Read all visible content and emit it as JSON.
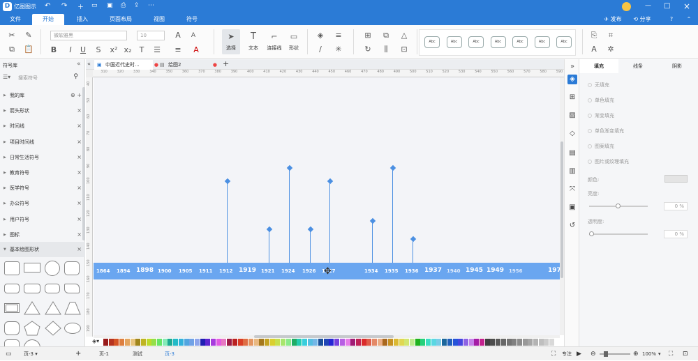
{
  "app": {
    "title": "亿图图示",
    "logo": "D"
  },
  "titlebar_right": {
    "publish": "发布",
    "share": "分享",
    "help": "?",
    "minimize": "—",
    "restore": "□",
    "close": "×"
  },
  "menu": {
    "file": "文件",
    "start": "开始",
    "insert": "插入",
    "page_layout": "页面布局",
    "view": "视图",
    "symbol": "符号"
  },
  "ribbon": {
    "font_name": "微软雅黑",
    "font_size": "10",
    "select_label": "选择",
    "text_label": "文本",
    "connector_label": "连接线",
    "shape_label": "形状",
    "style_boxes": [
      "Abc",
      "Abc",
      "Abc",
      "Abc",
      "Abc",
      "Abc",
      "Abc"
    ]
  },
  "left_panel": {
    "title": "符号库",
    "search_placeholder": "搜索符号",
    "items": [
      {
        "label": "我的库"
      },
      {
        "label": "箭头形状"
      },
      {
        "label": "时间线"
      },
      {
        "label": "项目时间线"
      },
      {
        "label": "日常生活符号"
      },
      {
        "label": "教育符号"
      },
      {
        "label": "医学符号"
      },
      {
        "label": "办公符号"
      },
      {
        "label": "用户符号"
      },
      {
        "label": "图标"
      }
    ],
    "open_section": "基本绘图形状"
  },
  "doc_tabs": [
    {
      "label": "中国近代史时..."
    },
    {
      "label": "绘图2"
    }
  ],
  "ruler": {
    "h": [
      "300",
      "310",
      "320",
      "330",
      "340",
      "350",
      "360",
      "370",
      "380",
      "390",
      "400",
      "410",
      "420",
      "430",
      "440",
      "450",
      "460",
      "470",
      "480",
      "490",
      "500",
      "510",
      "520",
      "530",
      "540",
      "550",
      "560",
      "570",
      "580",
      "590"
    ],
    "v": [
      "40",
      "50",
      "60",
      "70",
      "80",
      "90",
      "100",
      "110",
      "120",
      "130",
      "140",
      "150",
      "160",
      "170",
      "180",
      "190"
    ]
  },
  "timeline": {
    "years": [
      {
        "label": "1864",
        "big": false,
        "light": false
      },
      {
        "label": "1894",
        "big": false,
        "light": false
      },
      {
        "label": "1898",
        "big": true,
        "light": false
      },
      {
        "label": "1900",
        "big": false,
        "light": false
      },
      {
        "label": "1905",
        "big": false,
        "light": false
      },
      {
        "label": "1911",
        "big": false,
        "light": false
      },
      {
        "label": "1912",
        "big": false,
        "light": false
      },
      {
        "label": "1919",
        "big": true,
        "light": false
      },
      {
        "label": "1921",
        "big": false,
        "light": false
      },
      {
        "label": "1924",
        "big": false,
        "light": false
      },
      {
        "label": "1926",
        "big": false,
        "light": false
      },
      {
        "label": "1927",
        "big": false,
        "light": false
      },
      {
        "label": "1934",
        "big": false,
        "light": false
      },
      {
        "label": "1935",
        "big": false,
        "light": false
      },
      {
        "label": "1936",
        "big": false,
        "light": false
      },
      {
        "label": "1937",
        "big": true,
        "light": false
      },
      {
        "label": "1940",
        "big": false,
        "light": true
      },
      {
        "label": "1945",
        "big": true,
        "light": false
      },
      {
        "label": "1949",
        "big": true,
        "light": false
      },
      {
        "label": "1956",
        "big": false,
        "light": true
      },
      {
        "label": "197",
        "big": true,
        "light": false
      }
    ],
    "markers": [
      {
        "year": "1912",
        "height": 0.86
      },
      {
        "year": "1921",
        "height": 0.35
      },
      {
        "year": "1924",
        "height": 1.0
      },
      {
        "year": "1926",
        "height": 0.35
      },
      {
        "year": "1927",
        "height": 0.86
      },
      {
        "year": "1934",
        "height": 0.44
      },
      {
        "year": "1935",
        "height": 1.0
      },
      {
        "year": "1936",
        "height": 0.25
      }
    ],
    "band_color": "#6aa6f0",
    "marker_color": "#4b8fe2"
  },
  "right_panel": {
    "tabs": [
      "填充",
      "线条",
      "阴影"
    ],
    "fill_options": [
      "无填充",
      "单色填充",
      "渐变填充",
      "单色渐变填充",
      "图案填充",
      "图片或纹理填充"
    ],
    "color_label": "颜色:",
    "brightness_label": "亮度:",
    "brightness_value": "0 %",
    "transparency_label": "透明度:",
    "transparency_value": "0 %"
  },
  "status": {
    "page_selector": "页-3",
    "add_page": "+",
    "pages": [
      "页-1",
      "测试",
      "页-3"
    ],
    "focus": "专注",
    "zoom": "100%"
  },
  "colors": {
    "accent": "#2b7bd6"
  }
}
